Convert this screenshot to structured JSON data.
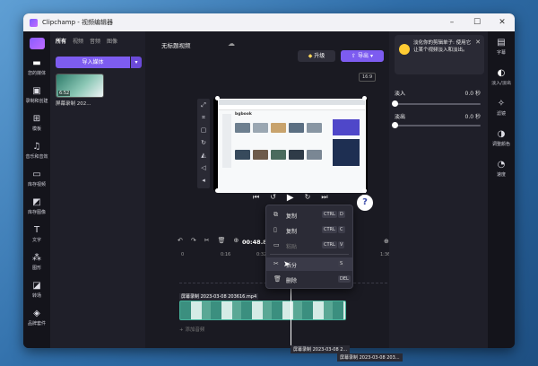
{
  "window": {
    "title": "Clipchamp - 视频编辑器"
  },
  "left_rail": [
    {
      "label": "您的媒体",
      "icon": "folder-icon"
    },
    {
      "label": "录制和创建",
      "icon": "camera-icon"
    },
    {
      "label": "模板",
      "icon": "grid-icon"
    },
    {
      "label": "音乐和音效",
      "icon": "music-icon"
    },
    {
      "label": "库存视频",
      "icon": "film-icon"
    },
    {
      "label": "库存图像",
      "icon": "image-icon"
    },
    {
      "label": "文字",
      "icon": "text-icon"
    },
    {
      "label": "图形",
      "icon": "shapes-icon"
    },
    {
      "label": "转场",
      "icon": "transition-icon"
    },
    {
      "label": "品牌套件",
      "icon": "brand-icon"
    }
  ],
  "media_panel": {
    "tabs": [
      "所有",
      "视频",
      "音频",
      "图像"
    ],
    "import_label": "导入媒体",
    "thumb_duration": "6:52",
    "thumb_label": "屏幕录制 202..."
  },
  "editor": {
    "project_name": "无标题视频",
    "upgrade_label": "升级",
    "export_label": "导出",
    "aspect_ratio": "16:9",
    "timecode": "00:48.8",
    "ruler": [
      "0",
      "0:16",
      "0:32",
      "1:36"
    ],
    "clip_name": "屏幕录制 2023-03-08 203616.mp4",
    "audio_hint": "+ 添加音频",
    "page_brand": "bgbook"
  },
  "context_menu": {
    "items": [
      {
        "icon": "copy-icon",
        "label": "复制",
        "k1": "CTRL",
        "k2": "D",
        "disabled": false
      },
      {
        "icon": "clipboard-icon",
        "label": "复制",
        "k1": "CTRL",
        "k2": "C",
        "disabled": false
      },
      {
        "icon": "paste-icon",
        "label": "粘贴",
        "k1": "CTRL",
        "k2": "V",
        "disabled": true
      },
      {
        "icon": "scissors-icon",
        "label": "拆分",
        "k1": "S",
        "k2": "",
        "disabled": false
      },
      {
        "icon": "trash-icon",
        "label": "删除",
        "k1": "DEL",
        "k2": "",
        "disabled": false
      }
    ]
  },
  "properties": {
    "notice": "淡化你的剪辑单子: 使用它让某个视频淡入和淡出。",
    "fade_in_label": "淡入",
    "fade_in_value": "0.0 秒",
    "fade_out_label": "淡出",
    "fade_out_value": "0.0 秒"
  },
  "right_rail": [
    {
      "label": "字幕",
      "icon": "captions-icon"
    },
    {
      "label": "淡入/淡出",
      "icon": "fade-icon"
    },
    {
      "label": "滤镜",
      "icon": "filter-icon"
    },
    {
      "label": "调整颜色",
      "icon": "color-icon"
    },
    {
      "label": "速度",
      "icon": "speed-icon"
    }
  ],
  "drag_labels": [
    "屏幕录制 2023-03-08 2...",
    "屏幕录制 2023-03-08 203..."
  ]
}
